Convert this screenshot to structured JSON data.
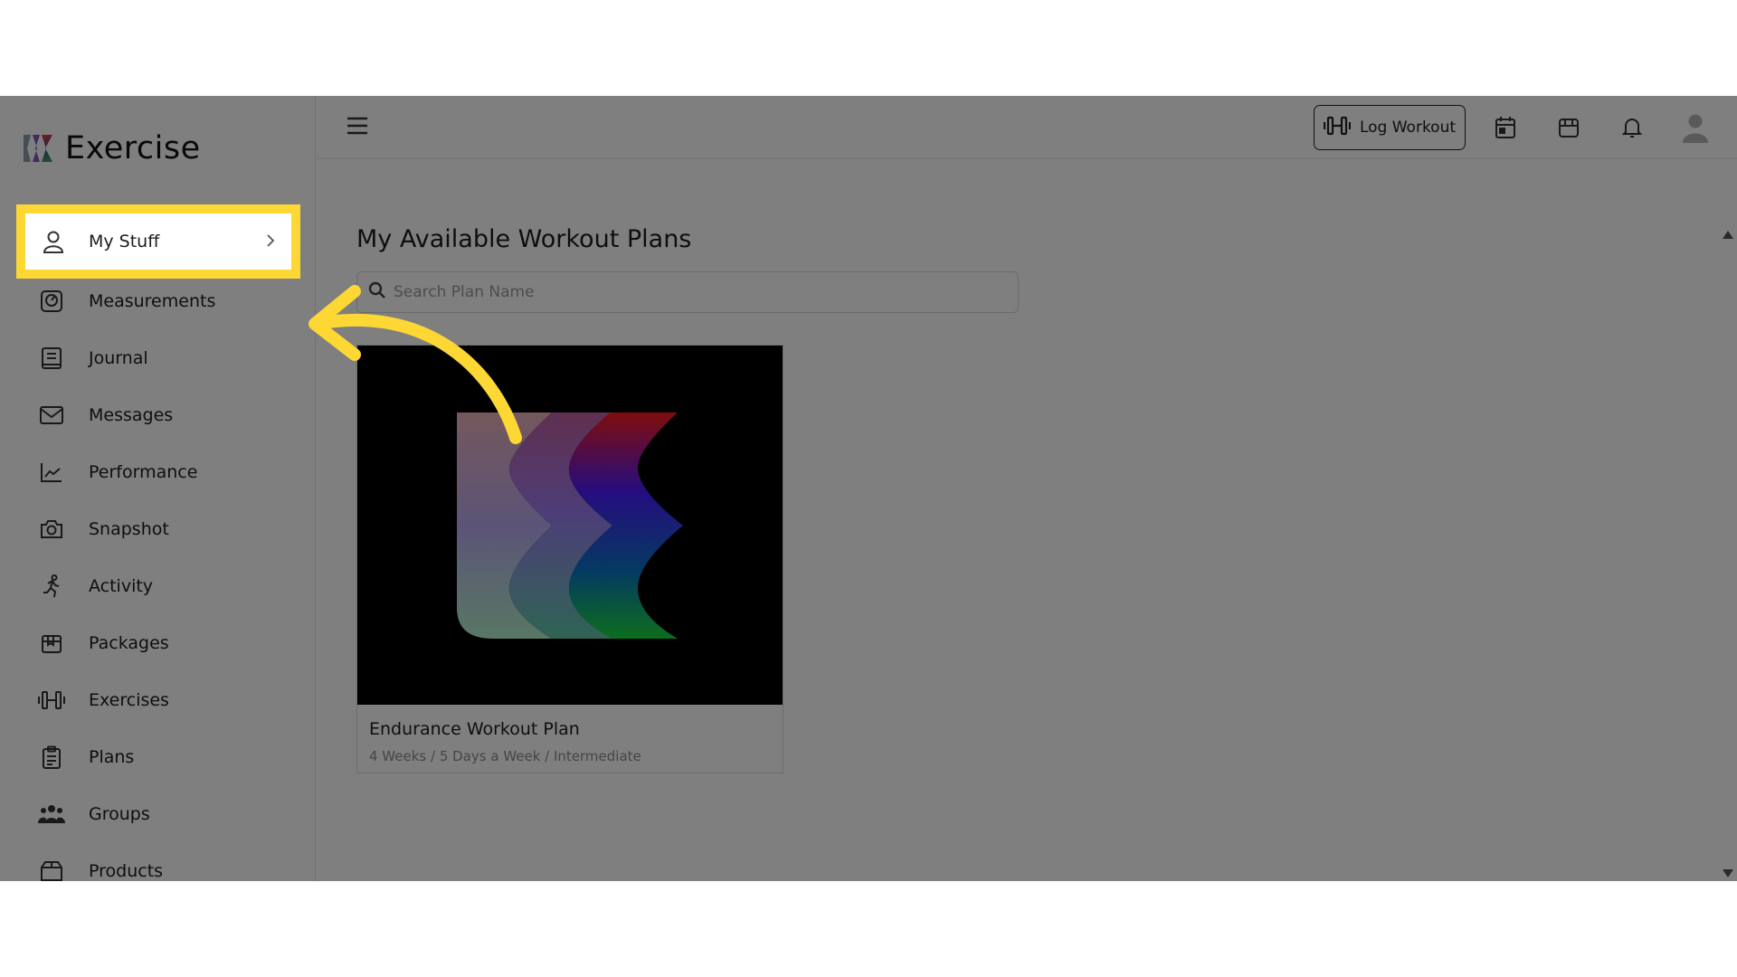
{
  "app": {
    "name": "Exercise"
  },
  "sidebar": {
    "items": [
      {
        "label": "My Stuff",
        "icon": "user-icon"
      },
      {
        "label": "Measurements",
        "icon": "scale-icon"
      },
      {
        "label": "Journal",
        "icon": "journal-icon"
      },
      {
        "label": "Messages",
        "icon": "mail-icon"
      },
      {
        "label": "Performance",
        "icon": "chart-icon"
      },
      {
        "label": "Snapshot",
        "icon": "camera-icon"
      },
      {
        "label": "Activity",
        "icon": "running-icon"
      },
      {
        "label": "Packages",
        "icon": "package-icon"
      },
      {
        "label": "Exercises",
        "icon": "dumbbell-icon"
      },
      {
        "label": "Plans",
        "icon": "clipboard-icon"
      },
      {
        "label": "Groups",
        "icon": "group-icon"
      },
      {
        "label": "Products",
        "icon": "products-icon"
      }
    ]
  },
  "topbar": {
    "log_workout_label": "Log Workout",
    "icons": [
      "calendar-icon",
      "box-icon",
      "bell-icon",
      "avatar-icon"
    ]
  },
  "main": {
    "title": "My Available Workout Plans",
    "search_placeholder": "Search Plan Name",
    "cards": [
      {
        "title": "Endurance Workout Plan",
        "subtitle": "4 Weeks / 5 Days a Week / Intermediate"
      }
    ]
  },
  "overlay": {
    "highlight_color": "#fdd835",
    "dim_opacity": "0.5"
  }
}
